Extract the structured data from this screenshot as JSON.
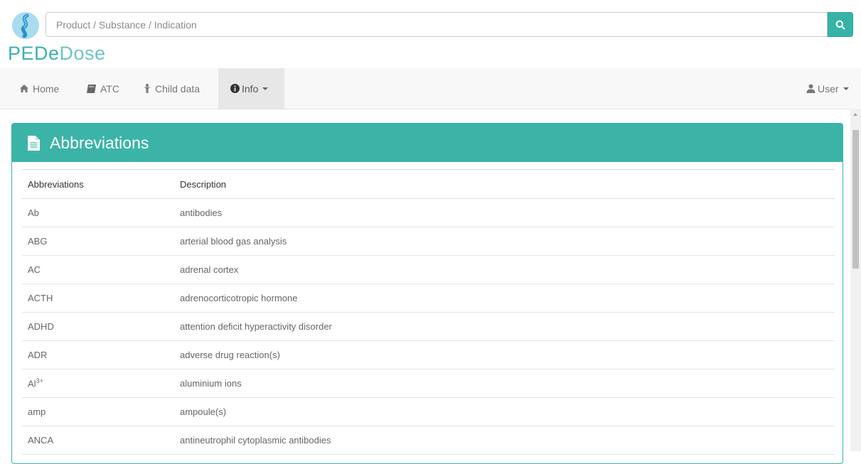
{
  "header": {
    "search": {
      "placeholder": "Product / Substance / Indication",
      "button_icon": "search-icon"
    },
    "brand": {
      "part1": "PEDe",
      "part2": "Dose"
    },
    "colors": {
      "accent": "#36b3a8",
      "brand": "#3ab2ad"
    }
  },
  "nav": {
    "home": {
      "label": "Home",
      "icon": "home-icon"
    },
    "atc": {
      "label": "ATC",
      "icon": "book-icon"
    },
    "child": {
      "label": "Child data",
      "icon": "child-icon"
    },
    "info": {
      "label": "Info",
      "icon": "info-circle-icon"
    },
    "user": {
      "label": "User",
      "icon": "user-icon"
    }
  },
  "panel": {
    "title": "Abbreviations",
    "icon": "document-icon",
    "columns": [
      "Abbreviations",
      "Description"
    ],
    "rows": [
      {
        "abbr": "Ab",
        "desc": "antibodies"
      },
      {
        "abbr": "ABG",
        "desc": "arterial blood gas analysis"
      },
      {
        "abbr": "AC",
        "desc": "adrenal cortex"
      },
      {
        "abbr": "ACTH",
        "desc": "adrenocorticotropic hormone"
      },
      {
        "abbr": "ADHD",
        "desc": "attention deficit hyperactivity disorder"
      },
      {
        "abbr": "ADR",
        "desc": "adverse drug reaction(s)"
      },
      {
        "abbr": "Al",
        "sup": "3+",
        "desc": "aluminium ions"
      },
      {
        "abbr": "amp",
        "desc": "ampoule(s)"
      },
      {
        "abbr": "ANCA",
        "desc": "antineutrophil cytoplasmic antibodies"
      }
    ]
  }
}
